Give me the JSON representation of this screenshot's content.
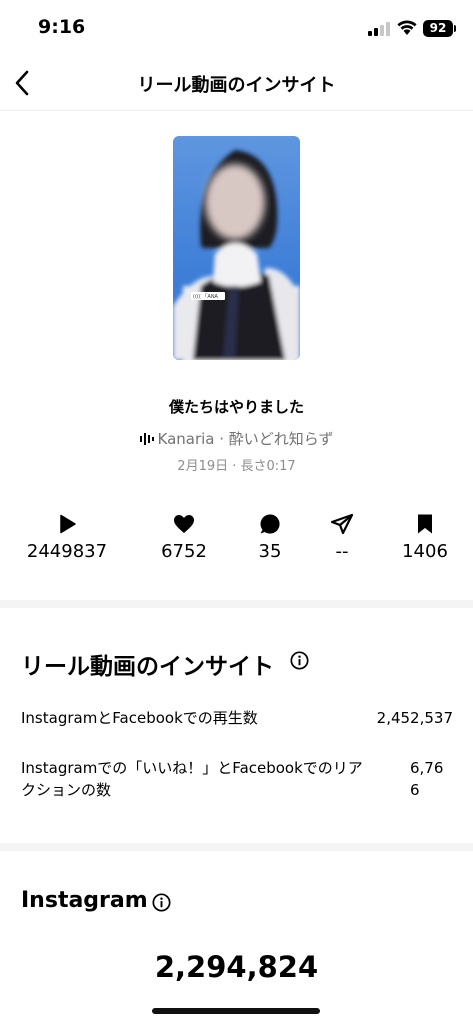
{
  "status": {
    "time": "9:16",
    "battery": "92"
  },
  "nav": {
    "title": "リール動画のインサイト"
  },
  "reel": {
    "title": "僕たちはやりました",
    "audio": "Kanaria · 酔いどれ知らず",
    "meta": "2月19日 · 長さ0:17",
    "sticker_text": "(((( 「ANA"
  },
  "stats": [
    {
      "icon": "play-icon",
      "value": "2449837"
    },
    {
      "icon": "heart-icon",
      "value": "6752"
    },
    {
      "icon": "comment-icon",
      "value": "35"
    },
    {
      "icon": "share-icon",
      "value": "--"
    },
    {
      "icon": "bookmark-icon",
      "value": "1406"
    }
  ],
  "insights": {
    "heading": "リール動画のインサイト",
    "rows": [
      {
        "label": "InstagramとFacebookでの再生数",
        "value": "2,452,537"
      },
      {
        "label_line1": "Instagramでの「いいね！」とFacebookでのリア",
        "label_line2": "クションの数",
        "value_line1": "6,76",
        "value_line2": "6"
      }
    ]
  },
  "instagram": {
    "heading": "Instagram",
    "total": "2,294,824"
  }
}
